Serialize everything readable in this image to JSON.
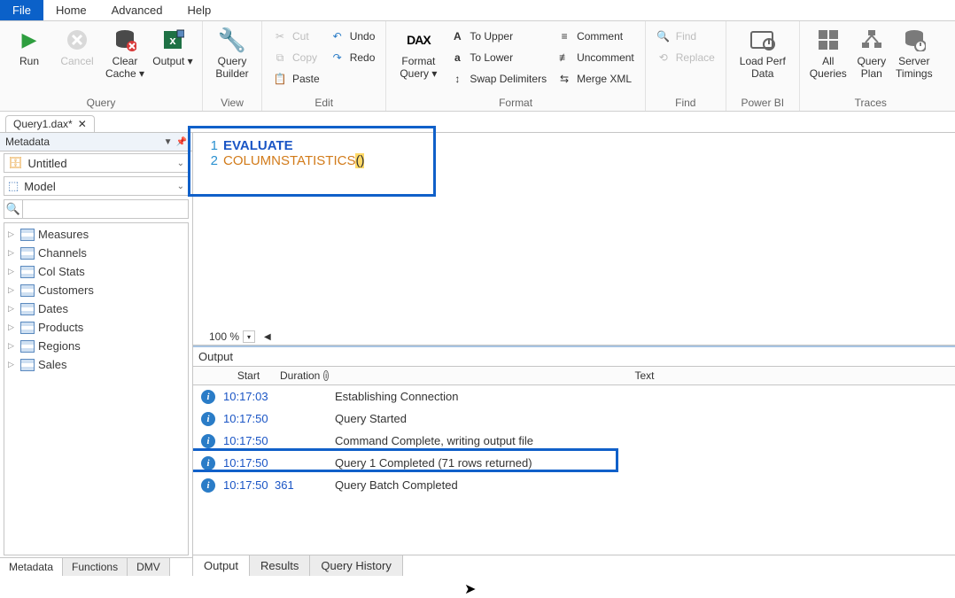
{
  "menu": {
    "file": "File",
    "home": "Home",
    "advanced": "Advanced",
    "help": "Help"
  },
  "ribbon": {
    "query": {
      "label": "Query",
      "run": "Run",
      "cancel": "Cancel",
      "clear_cache": "Clear Cache",
      "output": "Output"
    },
    "view": {
      "label": "View",
      "query_builder": "Query Builder"
    },
    "edit": {
      "label": "Edit",
      "cut": "Cut",
      "copy": "Copy",
      "paste": "Paste",
      "undo": "Undo",
      "redo": "Redo"
    },
    "format": {
      "label": "Format",
      "format_query": "Format Query",
      "to_upper": "To Upper",
      "to_lower": "To Lower",
      "swap_delim": "Swap Delimiters",
      "comment": "Comment",
      "uncomment": "Uncomment",
      "merge_xml": "Merge XML"
    },
    "find": {
      "label": "Find",
      "find": "Find",
      "replace": "Replace"
    },
    "powerbi": {
      "label": "Power BI",
      "load_perf": "Load Perf Data"
    },
    "traces": {
      "label": "Traces",
      "all_queries": "All Queries",
      "query_plan": "Query Plan",
      "server_timings": "Server Timings"
    }
  },
  "doctab": {
    "name": "Query1.dax*"
  },
  "metadata": {
    "title": "Metadata",
    "database": "Untitled",
    "model": "Model",
    "search_placeholder": "",
    "tables": [
      "Measures",
      "Channels",
      "Col Stats",
      "Customers",
      "Dates",
      "Products",
      "Regions",
      "Sales"
    ]
  },
  "bottom_tabs": {
    "metadata": "Metadata",
    "functions": "Functions",
    "dmv": "DMV"
  },
  "editor": {
    "lines": [
      {
        "n": "1",
        "kw": "EVALUATE"
      },
      {
        "n": "2",
        "fn": "COLUMNSTATISTICS",
        "par": "()"
      }
    ],
    "zoom": "100 %"
  },
  "output": {
    "title": "Output",
    "cols": {
      "start": "Start",
      "duration": "Duration",
      "text": "Text"
    },
    "rows": [
      {
        "start": "10:17:03",
        "dur": "",
        "text": "Establishing Connection"
      },
      {
        "start": "10:17:50",
        "dur": "",
        "text": "Query Started"
      },
      {
        "start": "10:17:50",
        "dur": "",
        "text": "Command Complete, writing output file"
      },
      {
        "start": "10:17:50",
        "dur": "",
        "text": "Query 1 Completed (71 rows returned)"
      },
      {
        "start": "10:17:50",
        "dur": "361",
        "text": "Query Batch Completed"
      }
    ],
    "tabs": {
      "output": "Output",
      "results": "Results",
      "history": "Query History"
    }
  }
}
